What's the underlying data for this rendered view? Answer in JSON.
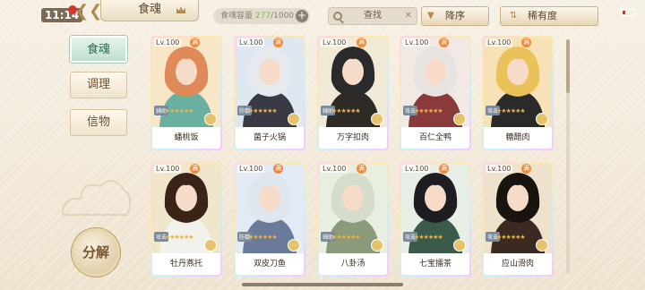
{
  "status": {
    "time": "11:14",
    "rec_badge": "60"
  },
  "header": {
    "title": "食魂",
    "capacity_label": "食魂容量",
    "capacity_current": "277",
    "capacity_max": "/1000",
    "search_label": "查找",
    "sort_label": "降序",
    "rarity_label": "稀有度"
  },
  "sidebar": {
    "tabs": [
      {
        "label": "食魂",
        "active": true
      },
      {
        "label": "调理",
        "active": false
      },
      {
        "label": "信物",
        "active": false
      }
    ],
    "decompose_label": "分解"
  },
  "cards": [
    {
      "level": "Lv.100",
      "name": "蟠桃饭",
      "role": "辅助",
      "bg": "#f8e6c8",
      "hair": "#e08a5a",
      "robe": "#6ab0a0"
    },
    {
      "level": "Lv.100",
      "name": "菌子火锅",
      "role": "防御",
      "bg": "#dfe8f0",
      "hair": "#e6e9ee",
      "robe": "#3a3a44"
    },
    {
      "level": "Lv.100",
      "name": "万字扣肉",
      "role": "辅助",
      "bg": "#f0ead6",
      "hair": "#2a2a2a",
      "robe": "#2e2a26"
    },
    {
      "level": "Lv.100",
      "name": "百仁全鸭",
      "role": "攻击",
      "bg": "#f2e8e4",
      "hair": "#e8e4e2",
      "robe": "#8a3a3a"
    },
    {
      "level": "Lv.100",
      "name": "糖醋肉",
      "role": "攻击",
      "bg": "#f6e2b6",
      "hair": "#e9c25a",
      "robe": "#2a2a2a"
    },
    {
      "level": "Lv.100",
      "name": "牡丹燕托",
      "role": "攻击",
      "bg": "#f0e6cc",
      "hair": "#3a2418",
      "robe": "#f2f2ec"
    },
    {
      "level": "Lv.100",
      "name": "双皮刀鱼",
      "role": "防御",
      "bg": "#e2eaf4",
      "hair": "#dfe6ee",
      "robe": "#6a7a9a"
    },
    {
      "level": "Lv.100",
      "name": "八卦汤",
      "role": "辅助",
      "bg": "#e8eee0",
      "hair": "#d6dccc",
      "robe": "#8a9a7a"
    },
    {
      "level": "Lv.100",
      "name": "七宝擂茶",
      "role": "攻击",
      "bg": "#e6eee6",
      "hair": "#1e1e22",
      "robe": "#3a5a4a"
    },
    {
      "level": "Lv.100",
      "name": "应山滑肉",
      "role": "攻击",
      "bg": "#efe2cc",
      "hair": "#1a1410",
      "robe": "#3a2a22"
    }
  ],
  "icons": {
    "crown": "crown-icon",
    "search": "search-icon",
    "clear": "close-icon",
    "sort": "sort-icon",
    "rarity": "sort-icon",
    "back": "back-icon"
  },
  "colors": {
    "accent_green": "#7bbf3a",
    "tab_active": "#2e6a55",
    "gold": "#e6b24a"
  }
}
